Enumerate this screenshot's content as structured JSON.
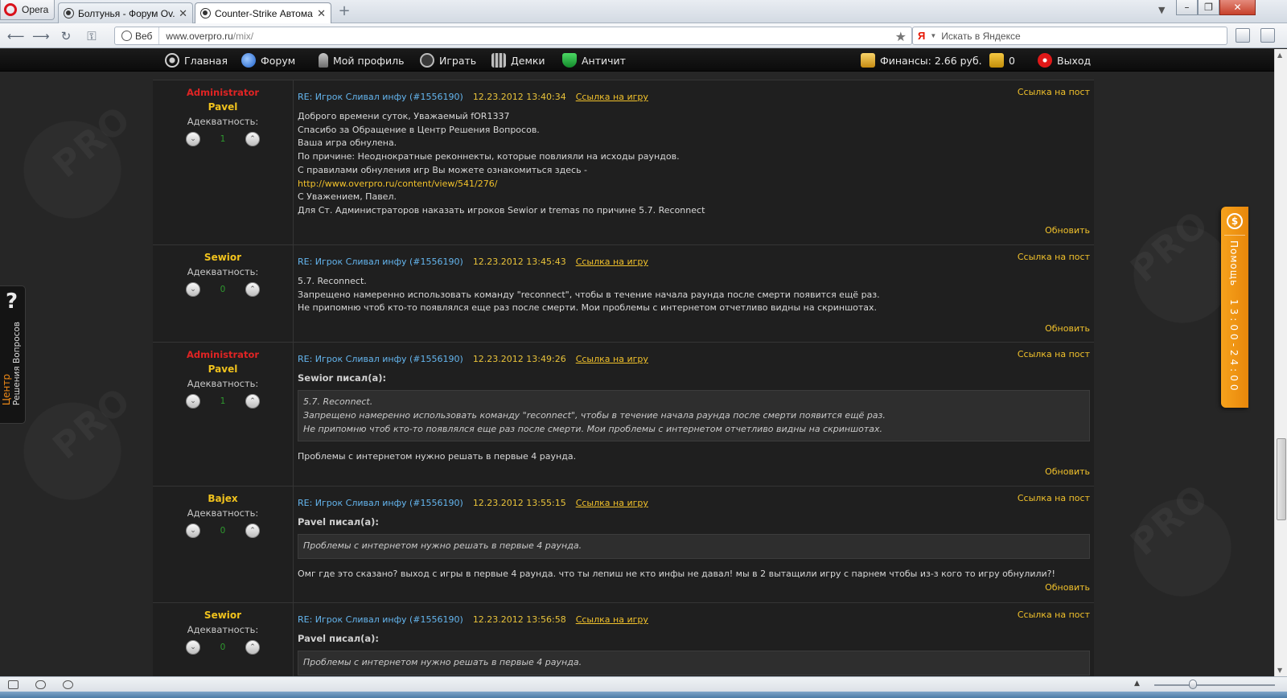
{
  "browser": {
    "menu_label": "Opera",
    "tabs": [
      {
        "title": "Болтунья - Форум Ov..."
      },
      {
        "title": "Counter-Strike Автома..."
      }
    ],
    "tab_close": "✕",
    "new_tab": "+",
    "web_badge": "Веб",
    "url_host": "www.overpro.ru",
    "url_path": "/mix/",
    "search_engine": "Я",
    "search_placeholder": "Искать в Яндексе",
    "window_controls": {
      "min": "–",
      "max": "❐",
      "close": "✕"
    }
  },
  "nav": {
    "items": [
      {
        "label": "Главная",
        "icon": "home-icon"
      },
      {
        "label": "Форум",
        "icon": "forum-icon"
      },
      {
        "label": "Мой профиль",
        "icon": "profile-icon"
      },
      {
        "label": "Играть",
        "icon": "play-icon"
      },
      {
        "label": "Демки",
        "icon": "demos-icon"
      },
      {
        "label": "Античит",
        "icon": "anticheat-shield-icon"
      }
    ],
    "finance": "Финансы: 2.66 руб.",
    "messages_count": "0",
    "logout": "Выход"
  },
  "labels": {
    "adequacy": "Адекватность:",
    "post_link": "Ссылка на пост",
    "game_link": "Ссылка на игру",
    "refresh": "Обновить",
    "minus": "⌄",
    "plus": "⌃"
  },
  "posts": [
    {
      "role": "Administrator",
      "author": "Pavel",
      "score": "1",
      "title": "RE: Игрок Сливал инфу (#1556190)",
      "date": "12.23.2012 13:40:34",
      "body": [
        "Доброго времени суток, Уважаемый fOR1337",
        "Спасибо за Обращение в Центр Решения Вопросов.",
        "Ваша игра обнулена.",
        "По причине: Неоднократные реконнекты, которые повлияли на исходы раундов.",
        "С правилами обнуления игр Вы можете ознакомиться здесь -",
        "http://www.overpro.ru/content/view/541/276/",
        "С Уважением, Павел.",
        "Для Ст. Администраторов наказать игроков Sewior и tremas по причине 5.7. Reconnect"
      ]
    },
    {
      "role": "",
      "author": "Sewior",
      "score": "0",
      "title": "RE: Игрок Сливал инфу (#1556190)",
      "date": "12.23.2012 13:45:43",
      "body": [
        "5.7. Reconnect.",
        "Запрещено намеренно использовать команду \"reconnect\", чтобы в течение начала раунда после смерти появится ещё раз.",
        "Не припомню чтоб кто-то появлялся еще раз после смерти. Мои проблемы с интернетом отчетливо видны на скриншотах."
      ]
    },
    {
      "role": "Administrator",
      "author": "Pavel",
      "score": "1",
      "title": "RE: Игрок Сливал инфу (#1556190)",
      "date": "12.23.2012 13:49:26",
      "quoter": "Sewior писал(а):",
      "quote": [
        "5.7. Reconnect.",
        "Запрещено намеренно использовать команду \"reconnect\", чтобы в течение начала раунда после смерти появится ещё раз.",
        "Не припомню чтоб кто-то появлялся еще раз после смерти. Мои проблемы с интернетом отчетливо видны на скриншотах."
      ],
      "reply": "Проблемы с интернетом нужно решать в первые 4 раунда."
    },
    {
      "role": "",
      "author": "Bajex",
      "score": "0",
      "title": "RE: Игрок Сливал инфу (#1556190)",
      "date": "12.23.2012 13:55:15",
      "quoter": "Pavel писал(а):",
      "quote": [
        "Проблемы с интернетом нужно решать в первые 4 раунда."
      ],
      "reply": "Омг где это сказано? выход с игры в первые 4 раунда. что ты лепиш не кто инфы не давал! мы в 2 вытащили игру с парнем чтобы из-з кого то игру обнулили?!"
    },
    {
      "role": "",
      "author": "Sewior",
      "score": "0",
      "title": "RE: Игрок Сливал инфу (#1556190)",
      "date": "12.23.2012 13:56:58",
      "quoter": "Pavel писал(а):",
      "quote": [
        "Проблемы с интернетом нужно решать в первые 4 раунда."
      ]
    }
  ],
  "help": {
    "label": "Помощь",
    "hours": "13:00-24:00",
    "icon": "help-chat-icon"
  },
  "center": {
    "q": "?",
    "line1": "Центр",
    "line2": "Решения Вопросов"
  },
  "colors": {
    "admin": "#e02424",
    "username": "#f0c21d",
    "title": "#64b5ee",
    "link": "#f1c12b",
    "help_tab": "#f39a19"
  }
}
